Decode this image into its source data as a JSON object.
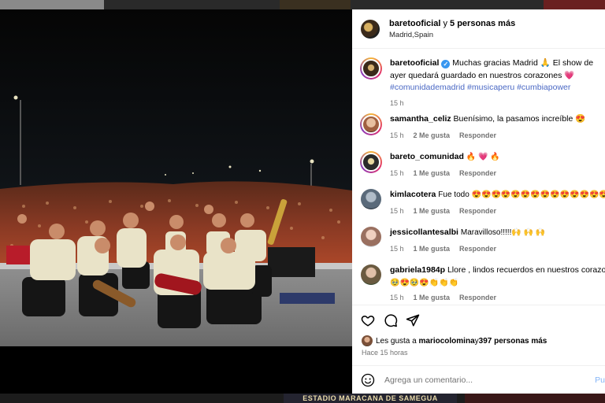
{
  "post": {
    "header": {
      "username": "baretooficial",
      "joiner": " y ",
      "others": "5 personas más",
      "location": "Madrid,Spain"
    },
    "caption": {
      "username": "baretooficial",
      "verified_glyph": "✓",
      "text": "Muchas gracias Madrid 🙏 El show de ayer quedará guardado en nuestros corazones 💗",
      "hashtags": "#comunidademadrid #musicaperu #cumbiapower",
      "time": "15 h"
    },
    "comments": [
      {
        "username": "samantha_celiz",
        "text": "Buenísimo, la pasamos increíble 😍",
        "time": "15 h",
        "likes": "2 Me gusta",
        "reply": "Responder"
      },
      {
        "username": "bareto_comunidad",
        "text": "🔥 💗 🔥",
        "time": "15 h",
        "likes": "1 Me gusta",
        "reply": "Responder"
      },
      {
        "username": "kimlacotera",
        "text": "Fue todo 😍😍😍😍😍😍😍😍😍😍😍😍😍😍",
        "time": "15 h",
        "likes": "1 Me gusta",
        "reply": "Responder"
      },
      {
        "username": "jessicollantesalbi",
        "text": "Maravilloso!!!!!🙌 🙌 🙌",
        "time": "15 h",
        "likes": "1 Me gusta",
        "reply": "Responder"
      },
      {
        "username": "gabriela1984p",
        "text": "Llore , lindos recuerdos en nuestros corazones",
        "text2": "🥹😍🥹😍👏👏👏",
        "time": "15 h",
        "likes": "1 Me gusta",
        "reply": "Responder"
      }
    ],
    "likes": {
      "prefix": "Les gusta a ",
      "user": "mariocolomina",
      "joiner": " y ",
      "count": "397 personas más"
    },
    "ago": "Hace 15 horas",
    "add_comment": {
      "placeholder": "Agrega un comentario...",
      "post": "Pu"
    },
    "background_banner": "ESTADIO MARACANA DE SAMEGUA"
  },
  "icons": {
    "like": "heart-icon",
    "comment": "comment-icon",
    "share": "share-icon",
    "emoji": "emoji-icon"
  },
  "colors": {
    "link": "#4a68c4",
    "muted": "#737373",
    "verified": "#3897f0",
    "post_button": "#85b5f7"
  }
}
